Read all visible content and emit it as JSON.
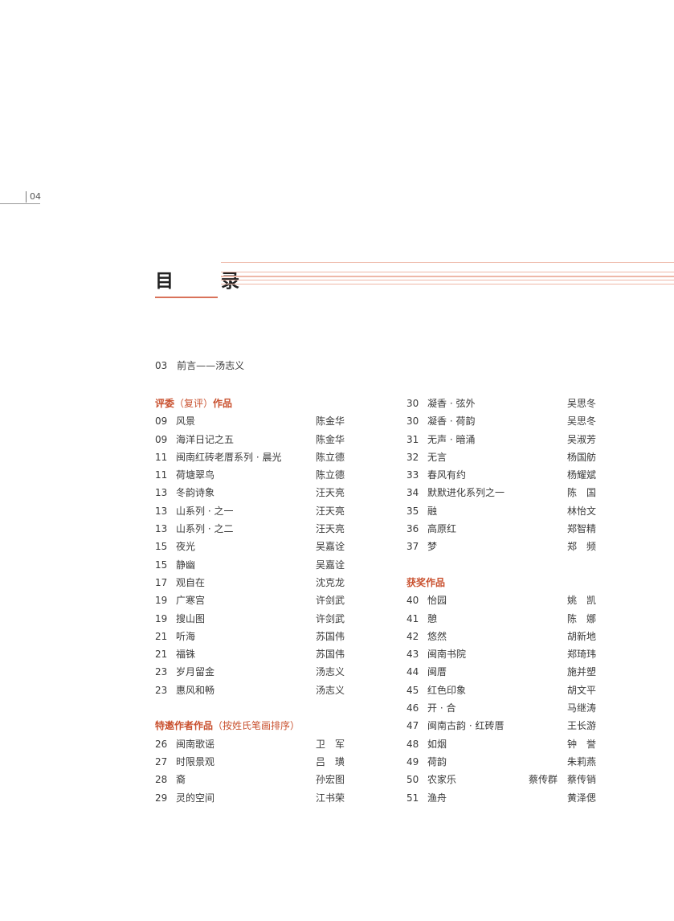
{
  "page_number": "04",
  "title": "目　录",
  "preface": {
    "num": "03",
    "text": "前言——汤志义"
  },
  "left_column": [
    {
      "kind": "section",
      "title": "评委",
      "note": "（复评）",
      "title_tail": "作品"
    },
    {
      "kind": "entry",
      "num": "09",
      "work": "风景",
      "author": "陈金华"
    },
    {
      "kind": "entry",
      "num": "09",
      "work": "海洋日记之五",
      "author": "陈金华"
    },
    {
      "kind": "entry",
      "num": "11",
      "work": "闽南红砖老厝系列 · 晨光",
      "author": "陈立德"
    },
    {
      "kind": "entry",
      "num": "11",
      "work": "荷塘翠鸟",
      "author": "陈立德"
    },
    {
      "kind": "entry",
      "num": "13",
      "work": "冬韵诗象",
      "author": "汪天亮"
    },
    {
      "kind": "entry",
      "num": "13",
      "work": "山系列 · 之一",
      "author": "汪天亮"
    },
    {
      "kind": "entry",
      "num": "13",
      "work": "山系列 · 之二",
      "author": "汪天亮"
    },
    {
      "kind": "entry",
      "num": "15",
      "work": "夜光",
      "author": "吴嘉诠"
    },
    {
      "kind": "entry",
      "num": "15",
      "work": "静幽",
      "author": "吴嘉诠"
    },
    {
      "kind": "entry",
      "num": "17",
      "work": "观自在",
      "author": "沈克龙"
    },
    {
      "kind": "entry",
      "num": "19",
      "work": "广寒宫",
      "author": "许剑武"
    },
    {
      "kind": "entry",
      "num": "19",
      "work": "搜山图",
      "author": "许剑武"
    },
    {
      "kind": "entry",
      "num": "21",
      "work": "听海",
      "author": "苏国伟"
    },
    {
      "kind": "entry",
      "num": "21",
      "work": "福铢",
      "author": "苏国伟"
    },
    {
      "kind": "entry",
      "num": "23",
      "work": "岁月留金",
      "author": "汤志义"
    },
    {
      "kind": "entry",
      "num": "23",
      "work": "惠风和畅",
      "author": "汤志义"
    },
    {
      "kind": "spacer"
    },
    {
      "kind": "section",
      "title": "特邀作者作品",
      "note": "（按姓氏笔画排序）",
      "title_tail": ""
    },
    {
      "kind": "entry",
      "num": "26",
      "work": "闽南歌谣",
      "author": "卫　军"
    },
    {
      "kind": "entry",
      "num": "27",
      "work": "时限景观",
      "author": "吕　璜"
    },
    {
      "kind": "entry",
      "num": "28",
      "work": "裔",
      "author": "孙宏图"
    },
    {
      "kind": "entry",
      "num": "29",
      "work": "灵的空间",
      "author": "江书荣"
    }
  ],
  "right_column": [
    {
      "kind": "entry",
      "num": "30",
      "work": "凝香 · 弦外",
      "author": "吴思冬"
    },
    {
      "kind": "entry",
      "num": "30",
      "work": "凝香 · 荷韵",
      "author": "吴思冬"
    },
    {
      "kind": "entry",
      "num": "31",
      "work": "无声 · 暗涌",
      "author": "吴淑芳"
    },
    {
      "kind": "entry",
      "num": "32",
      "work": "无言",
      "author": "杨国舫"
    },
    {
      "kind": "entry",
      "num": "33",
      "work": "春风有约",
      "author": "杨耀斌"
    },
    {
      "kind": "entry",
      "num": "34",
      "work": "默默进化系列之一",
      "author": "陈　国"
    },
    {
      "kind": "entry",
      "num": "35",
      "work": "融",
      "author": "林怡文"
    },
    {
      "kind": "entry",
      "num": "36",
      "work": "高原红",
      "author": "郑智精"
    },
    {
      "kind": "entry",
      "num": "37",
      "work": "梦",
      "author": "郑　频"
    },
    {
      "kind": "spacer"
    },
    {
      "kind": "section",
      "title": "获奖作品",
      "note": "",
      "title_tail": ""
    },
    {
      "kind": "entry",
      "num": "40",
      "work": "怡园",
      "author": "姚　凯"
    },
    {
      "kind": "entry",
      "num": "41",
      "work": "憩",
      "author": "陈　娜"
    },
    {
      "kind": "entry",
      "num": "42",
      "work": "悠然",
      "author": "胡新地"
    },
    {
      "kind": "entry",
      "num": "43",
      "work": "闽南书院",
      "author": "郑琦玮"
    },
    {
      "kind": "entry",
      "num": "44",
      "work": "闽厝",
      "author": "施并塑"
    },
    {
      "kind": "entry",
      "num": "45",
      "work": "红色印象",
      "author": "胡文平"
    },
    {
      "kind": "entry",
      "num": "46",
      "work": "开 · 合",
      "author": "马继涛"
    },
    {
      "kind": "entry",
      "num": "47",
      "work": "闽南古韵 · 红砖厝",
      "author": "王长游"
    },
    {
      "kind": "entry",
      "num": "48",
      "work": "如烟",
      "author": "钟　誉"
    },
    {
      "kind": "entry",
      "num": "49",
      "work": "荷韵",
      "author": "朱莉燕"
    },
    {
      "kind": "entry",
      "num": "50",
      "work": "农家乐",
      "author": "蔡传群　蔡传销"
    },
    {
      "kind": "entry",
      "num": "51",
      "work": "渔舟",
      "author": "黄泽偲"
    }
  ]
}
